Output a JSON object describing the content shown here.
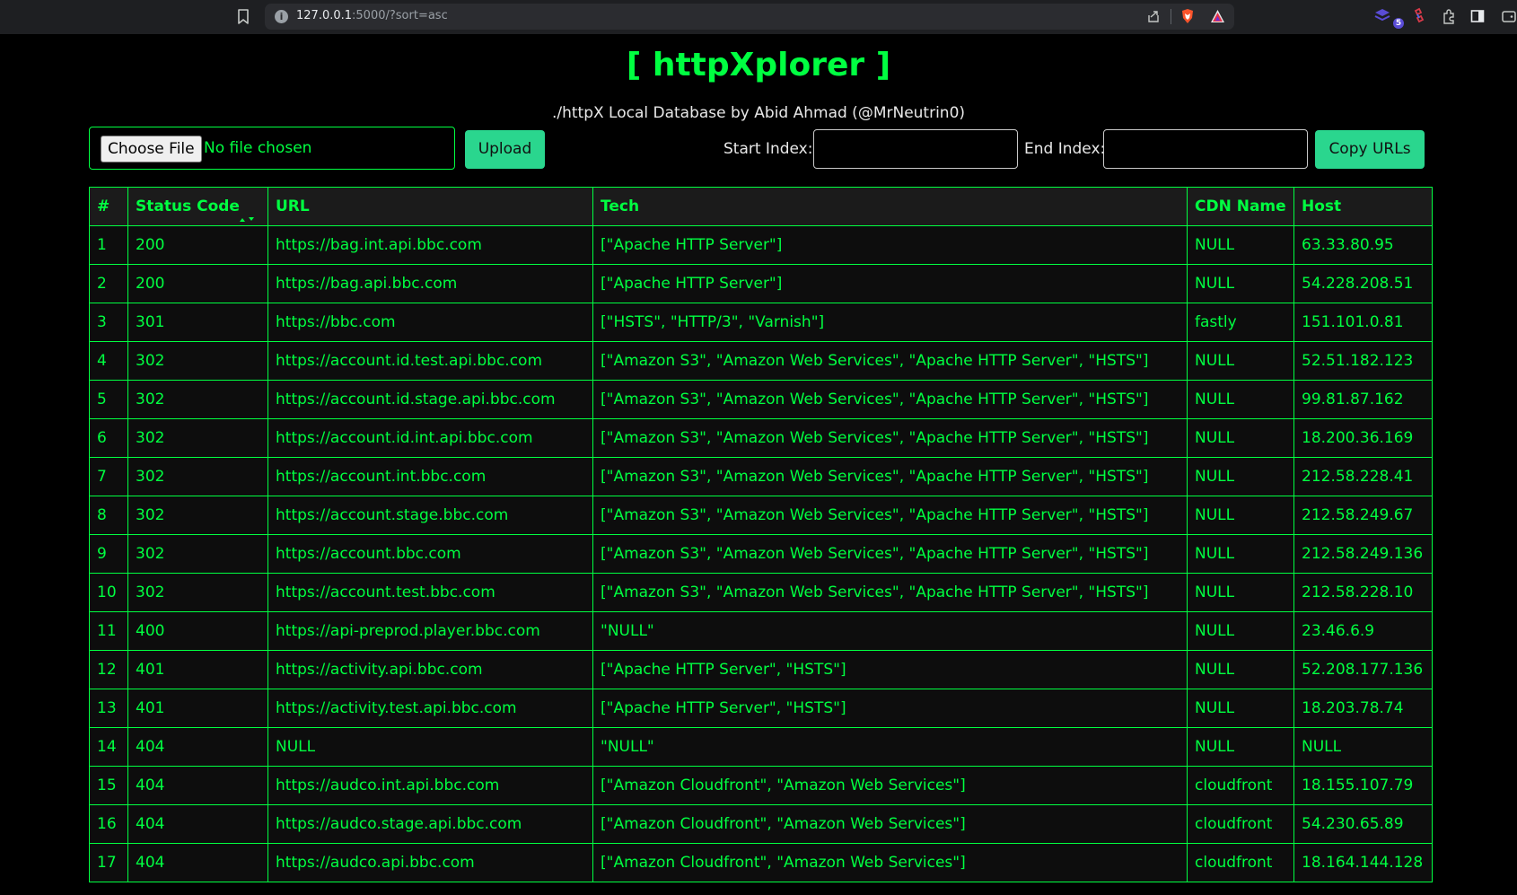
{
  "browser": {
    "url_host": "127.0.0.1",
    "url_rest": ":5000/?sort=asc",
    "info_glyph": "i",
    "extension_badge": "5"
  },
  "header": {
    "title": "[ httpXplorer ]",
    "subtitle": "./httpX Local Database by Abid Ahmad (@MrNeutrin0)"
  },
  "controls": {
    "choose_file_label": "Choose File",
    "no_file_text": "No file chosen",
    "upload_label": "Upload",
    "start_index_label": "Start Index:",
    "start_index_value": "",
    "end_index_label": "End Index:",
    "end_index_value": "",
    "copy_urls_label": "Copy URLs"
  },
  "table": {
    "sort_column": "Status Code",
    "sort_order": "asc",
    "headers": [
      "#",
      "Status Code",
      "URL",
      "Tech",
      "CDN Name",
      "Host"
    ],
    "rows": [
      [
        "1",
        "200",
        "https://bag.int.api.bbc.com",
        "[\"Apache HTTP Server\"]",
        "NULL",
        "63.33.80.95"
      ],
      [
        "2",
        "200",
        "https://bag.api.bbc.com",
        "[\"Apache HTTP Server\"]",
        "NULL",
        "54.228.208.51"
      ],
      [
        "3",
        "301",
        "https://bbc.com",
        "[\"HSTS\", \"HTTP/3\", \"Varnish\"]",
        "fastly",
        "151.101.0.81"
      ],
      [
        "4",
        "302",
        "https://account.id.test.api.bbc.com",
        "[\"Amazon S3\", \"Amazon Web Services\", \"Apache HTTP Server\", \"HSTS\"]",
        "NULL",
        "52.51.182.123"
      ],
      [
        "5",
        "302",
        "https://account.id.stage.api.bbc.com",
        "[\"Amazon S3\", \"Amazon Web Services\", \"Apache HTTP Server\", \"HSTS\"]",
        "NULL",
        "99.81.87.162"
      ],
      [
        "6",
        "302",
        "https://account.id.int.api.bbc.com",
        "[\"Amazon S3\", \"Amazon Web Services\", \"Apache HTTP Server\", \"HSTS\"]",
        "NULL",
        "18.200.36.169"
      ],
      [
        "7",
        "302",
        "https://account.int.bbc.com",
        "[\"Amazon S3\", \"Amazon Web Services\", \"Apache HTTP Server\", \"HSTS\"]",
        "NULL",
        "212.58.228.41"
      ],
      [
        "8",
        "302",
        "https://account.stage.bbc.com",
        "[\"Amazon S3\", \"Amazon Web Services\", \"Apache HTTP Server\", \"HSTS\"]",
        "NULL",
        "212.58.249.67"
      ],
      [
        "9",
        "302",
        "https://account.bbc.com",
        "[\"Amazon S3\", \"Amazon Web Services\", \"Apache HTTP Server\", \"HSTS\"]",
        "NULL",
        "212.58.249.136"
      ],
      [
        "10",
        "302",
        "https://account.test.bbc.com",
        "[\"Amazon S3\", \"Amazon Web Services\", \"Apache HTTP Server\", \"HSTS\"]",
        "NULL",
        "212.58.228.10"
      ],
      [
        "11",
        "400",
        "https://api-preprod.player.bbc.com",
        "\"NULL\"",
        "NULL",
        "23.46.6.9"
      ],
      [
        "12",
        "401",
        "https://activity.api.bbc.com",
        "[\"Apache HTTP Server\", \"HSTS\"]",
        "NULL",
        "52.208.177.136"
      ],
      [
        "13",
        "401",
        "https://activity.test.api.bbc.com",
        "[\"Apache HTTP Server\", \"HSTS\"]",
        "NULL",
        "18.203.78.74"
      ],
      [
        "14",
        "404",
        "NULL",
        "\"NULL\"",
        "NULL",
        "NULL"
      ],
      [
        "15",
        "404",
        "https://audco.int.api.bbc.com",
        "[\"Amazon Cloudfront\", \"Amazon Web Services\"]",
        "cloudfront",
        "18.155.107.79"
      ],
      [
        "16",
        "404",
        "https://audco.stage.api.bbc.com",
        "[\"Amazon Cloudfront\", \"Amazon Web Services\"]",
        "cloudfront",
        "54.230.65.89"
      ],
      [
        "17",
        "404",
        "https://audco.api.bbc.com",
        "[\"Amazon Cloudfront\", \"Amazon Web Services\"]",
        "cloudfront",
        "18.164.144.128"
      ]
    ]
  },
  "icons": {
    "bookmark": "bookmark-icon",
    "site_info": "info-icon",
    "share": "share-icon",
    "brave_shield": "brave-shield-icon",
    "brave_rewards": "brave-rewards-icon",
    "extensions": "puzzle-icon",
    "sidebar": "sidebar-icon",
    "sort": "sort-arrows-icon"
  },
  "colors": {
    "accent_green": "#00ff41",
    "button_green": "#2ad68e",
    "background": "#000000"
  }
}
